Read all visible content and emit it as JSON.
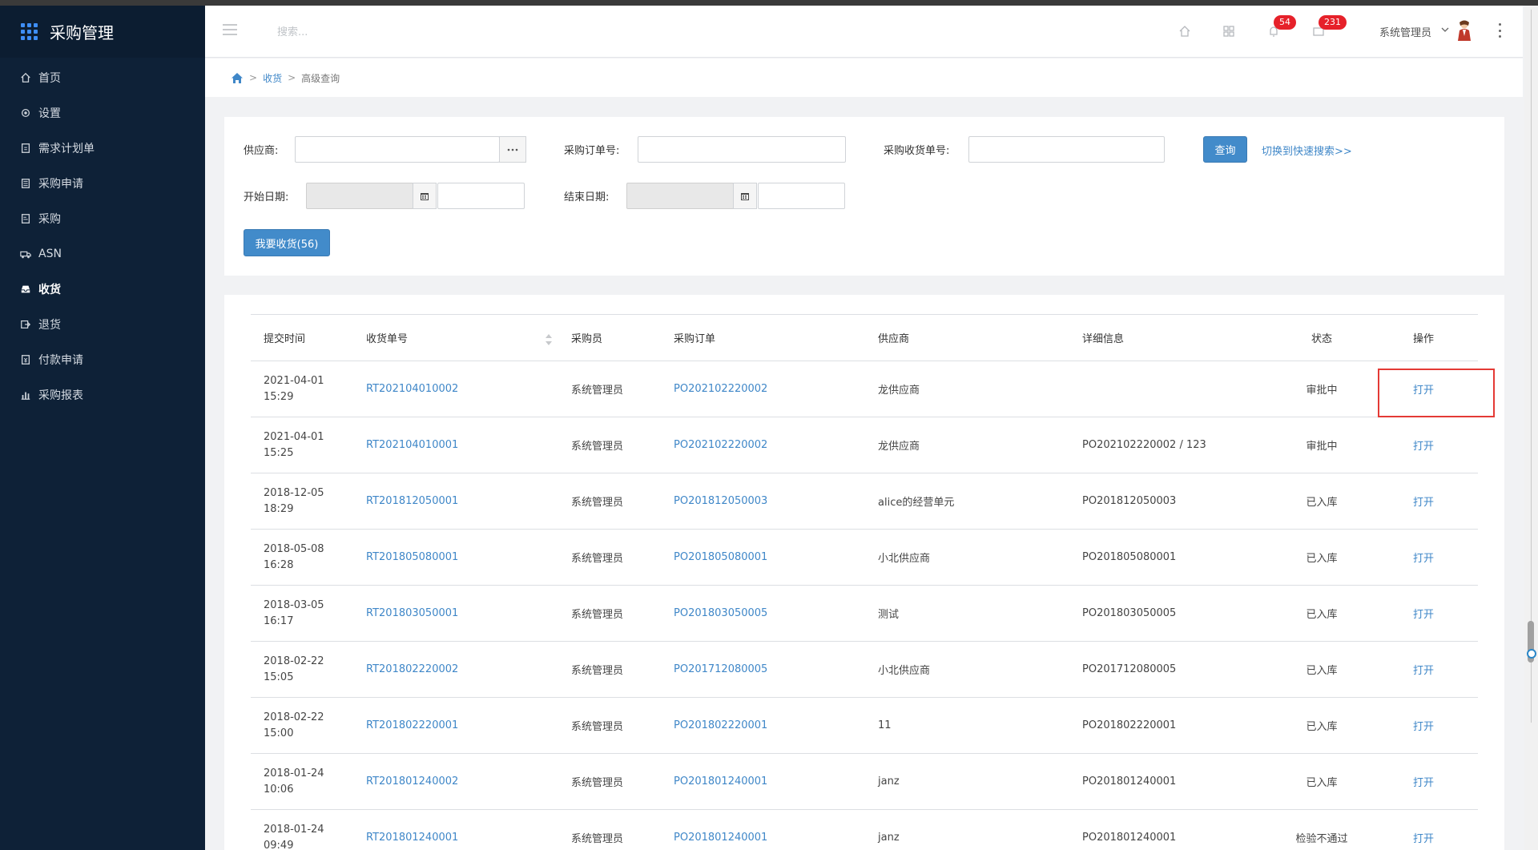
{
  "app": {
    "title": "采购管理"
  },
  "sidebar": {
    "items": [
      {
        "label": "首页",
        "icon": "home-icon"
      },
      {
        "label": "设置",
        "icon": "gear-icon"
      },
      {
        "label": "需求计划单",
        "icon": "document-icon"
      },
      {
        "label": "采购申请",
        "icon": "clipboard-icon"
      },
      {
        "label": "采购",
        "icon": "list-icon"
      },
      {
        "label": "ASN",
        "icon": "truck-icon"
      },
      {
        "label": "收货",
        "icon": "inbox-icon",
        "active": true
      },
      {
        "label": "退货",
        "icon": "return-icon"
      },
      {
        "label": "付款申请",
        "icon": "payment-icon"
      },
      {
        "label": "采购报表",
        "icon": "bar-chart-icon"
      }
    ]
  },
  "header": {
    "search_placeholder": "搜索...",
    "notifications_count": "54",
    "messages_count": "231",
    "user_name": "系统管理员"
  },
  "breadcrumb": {
    "level1": "收货",
    "level2": "高级查询"
  },
  "filters": {
    "supplier_label": "供应商:",
    "supplier_value": "",
    "po_label": "采购订单号:",
    "po_value": "",
    "receipt_label": "采购收货单号:",
    "receipt_value": "",
    "query_button": "查询",
    "quick_search_link": "切换到快速搜索>>",
    "start_date_label": "开始日期:",
    "end_date_label": "结束日期:",
    "receive_button": "我要收货(56)"
  },
  "table": {
    "headers": [
      "提交时间",
      "收货单号",
      "采购员",
      "采购订单",
      "供应商",
      "详细信息",
      "状态",
      "操作"
    ],
    "rows": [
      {
        "date": "2021-04-01",
        "time": "15:29",
        "receipt": "RT202104010002",
        "buyer": "系统管理员",
        "po": "PO202102220002",
        "supplier": "龙供应商",
        "detail": "",
        "status": "审批中",
        "action": "打开"
      },
      {
        "date": "2021-04-01",
        "time": "15:25",
        "receipt": "RT202104010001",
        "buyer": "系统管理员",
        "po": "PO202102220002",
        "supplier": "龙供应商",
        "detail": "PO202102220002 / 123",
        "status": "审批中",
        "action": "打开"
      },
      {
        "date": "2018-12-05",
        "time": "18:29",
        "receipt": "RT201812050001",
        "buyer": "系统管理员",
        "po": "PO201812050003",
        "supplier": "alice的经营单元",
        "detail": "PO201812050003",
        "status": "已入库",
        "action": "打开"
      },
      {
        "date": "2018-05-08",
        "time": "16:28",
        "receipt": "RT201805080001",
        "buyer": "系统管理员",
        "po": "PO201805080001",
        "supplier": "小北供应商",
        "detail": "PO201805080001",
        "status": "已入库",
        "action": "打开"
      },
      {
        "date": "2018-03-05",
        "time": "16:17",
        "receipt": "RT201803050001",
        "buyer": "系统管理员",
        "po": "PO201803050005",
        "supplier": "测试",
        "detail": "PO201803050005",
        "status": "已入库",
        "action": "打开"
      },
      {
        "date": "2018-02-22",
        "time": "15:05",
        "receipt": "RT201802220002",
        "buyer": "系统管理员",
        "po": "PO201712080005",
        "supplier": "小北供应商",
        "detail": "PO201712080005",
        "status": "已入库",
        "action": "打开"
      },
      {
        "date": "2018-02-22",
        "time": "15:00",
        "receipt": "RT201802220001",
        "buyer": "系统管理员",
        "po": "PO201802220001",
        "supplier": "11",
        "detail": "PO201802220001",
        "status": "已入库",
        "action": "打开"
      },
      {
        "date": "2018-01-24",
        "time": "10:06",
        "receipt": "RT201801240002",
        "buyer": "系统管理员",
        "po": "PO201801240001",
        "supplier": "janz",
        "detail": "PO201801240001",
        "status": "已入库",
        "action": "打开"
      },
      {
        "date": "2018-01-24",
        "time": "09:49",
        "receipt": "RT201801240001",
        "buyer": "系统管理员",
        "po": "PO201801240001",
        "supplier": "janz",
        "detail": "PO201801240001",
        "status": "检验不通过",
        "action": "打开"
      }
    ]
  },
  "colors": {
    "sidebar_bg": "#0e2137",
    "accent": "#428bca",
    "link": "#3f87c8",
    "badge": "#e6212a",
    "highlight": "#e43a35"
  }
}
